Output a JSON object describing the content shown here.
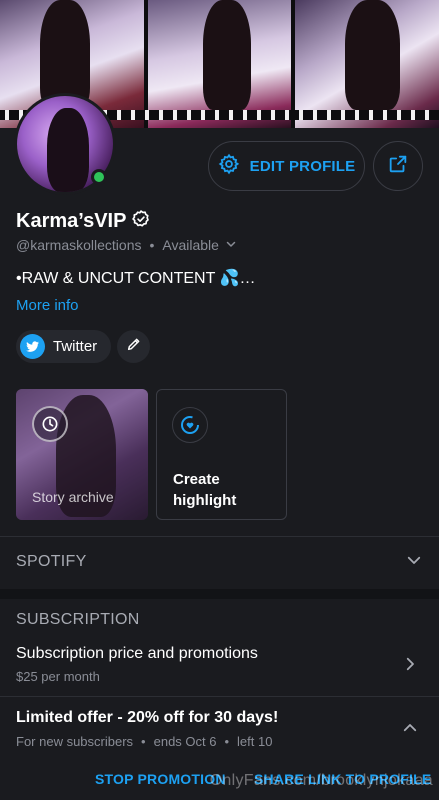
{
  "profile": {
    "name": "Karma’sVIP",
    "handle": "@karmaskollections",
    "status": "Available",
    "bio": "•RAW & UNCUT CONTENT 💦…",
    "more_info": "More info"
  },
  "actions": {
    "edit_profile": "EDIT PROFILE"
  },
  "social": {
    "twitter_label": "Twitter"
  },
  "highlights": {
    "archive_label": "Story archive",
    "create_label": "Create highlight"
  },
  "sections": {
    "spotify": "SPOTIFY",
    "subscription": "SUBSCRIPTION"
  },
  "subscription": {
    "title": "Subscription price and promotions",
    "price": "$25 per month"
  },
  "offer": {
    "title": "Limited offer - 20% off for 30 days!",
    "audience": "For new subscribers",
    "ends": "ends Oct 6",
    "left": "left 10",
    "separator": "•"
  },
  "offer_actions": {
    "stop": "STOP PROMOTION",
    "share": "SHARE LINK TO PROFILE"
  },
  "watermark": "OnlyFans.com/brooklynjokaaa",
  "colors": {
    "accent": "#1da1f2",
    "online": "#2fc45a",
    "background": "#1a1b1f"
  }
}
